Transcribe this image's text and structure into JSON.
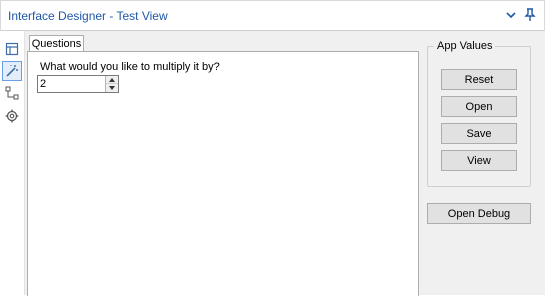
{
  "window": {
    "title": "Interface Designer - Test View",
    "accent": "#1f57a8"
  },
  "sidebar": {
    "items": [
      {
        "name": "layout-icon"
      },
      {
        "name": "magic-wand-icon"
      },
      {
        "name": "tree-icon"
      },
      {
        "name": "gear-icon"
      }
    ]
  },
  "tabs": [
    "Questions"
  ],
  "questions": {
    "prompt": "What would you like to multiply it by?",
    "value": "2"
  },
  "app_values": {
    "label": "App Values",
    "buttons": [
      "Reset",
      "Open",
      "Save",
      "View"
    ]
  },
  "debug": {
    "label": "Open Debug"
  }
}
